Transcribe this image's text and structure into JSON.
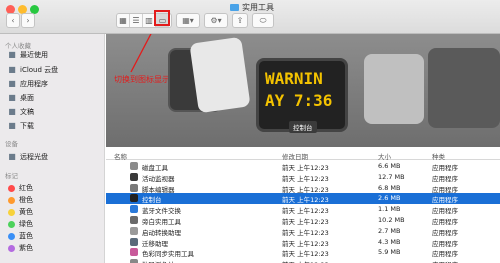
{
  "window": {
    "title": "实用工具"
  },
  "colors": {
    "accent": "#1a6fd6",
    "annotation": "#e31b1b"
  },
  "annotation": {
    "text": "切换到图标显示"
  },
  "sidebar": {
    "sections": [
      {
        "heading": "个人收藏",
        "items": [
          {
            "label": "最近使用",
            "icon": "clock-icon"
          },
          {
            "label": "iCloud 云盘",
            "icon": "cloud-icon"
          },
          {
            "label": "应用程序",
            "icon": "apps-icon"
          },
          {
            "label": "桌面",
            "icon": "desktop-icon"
          },
          {
            "label": "文稿",
            "icon": "document-icon"
          },
          {
            "label": "下载",
            "icon": "download-icon"
          }
        ]
      },
      {
        "heading": "设备",
        "items": [
          {
            "label": "远程光盘",
            "icon": "disc-icon"
          }
        ]
      },
      {
        "heading": "标记",
        "items": [
          {
            "label": "红色",
            "color": "#ff4a4a"
          },
          {
            "label": "橙色",
            "color": "#ff9a2e"
          },
          {
            "label": "黄色",
            "color": "#f7d23b"
          },
          {
            "label": "绿色",
            "color": "#4cd15b"
          },
          {
            "label": "蓝色",
            "color": "#3a8ff6"
          },
          {
            "label": "紫色",
            "color": "#b46be0"
          }
        ]
      }
    ]
  },
  "gallery": {
    "caption": "控制台",
    "console_text1": "WARNIN",
    "console_text2": "AY 7:36"
  },
  "list": {
    "headers": {
      "name": "名称",
      "date": "修改日期",
      "size": "大小",
      "kind": "种类"
    },
    "rows": [
      {
        "name": "磁盘工具",
        "date": "前天 上午12:23",
        "size": "6.6 MB",
        "kind": "应用程序",
        "color": "#8b8b8b"
      },
      {
        "name": "活动监视器",
        "date": "前天 上午12:23",
        "size": "12.7 MB",
        "kind": "应用程序",
        "color": "#3a3a3a"
      },
      {
        "name": "脚本编辑器",
        "date": "前天 上午12:23",
        "size": "6.8 MB",
        "kind": "应用程序",
        "color": "#7a7a7a"
      },
      {
        "name": "控制台",
        "date": "前天 上午12:23",
        "size": "2.6 MB",
        "kind": "应用程序",
        "color": "#222222",
        "selected": true
      },
      {
        "name": "蓝牙文件交换",
        "date": "前天 上午12:23",
        "size": "1.1 MB",
        "kind": "应用程序",
        "color": "#2a79d9"
      },
      {
        "name": "旁白实用工具",
        "date": "前天 上午12:23",
        "size": "10.2 MB",
        "kind": "应用程序",
        "color": "#6a6a6a"
      },
      {
        "name": "启动转换助理",
        "date": "前天 上午12:23",
        "size": "2.7 MB",
        "kind": "应用程序",
        "color": "#9a9a9a"
      },
      {
        "name": "迁移助理",
        "date": "前天 上午12:23",
        "size": "4.3 MB",
        "kind": "应用程序",
        "color": "#5a6a7a"
      },
      {
        "name": "色彩同步实用工具",
        "date": "前天 上午12:23",
        "size": "5.9 MB",
        "kind": "应用程序",
        "color": "#c85a9a"
      },
      {
        "name": "数码测色计",
        "date": "前天 上午12:23",
        "size": "",
        "kind": "应用程序",
        "color": "#888888"
      }
    ]
  }
}
